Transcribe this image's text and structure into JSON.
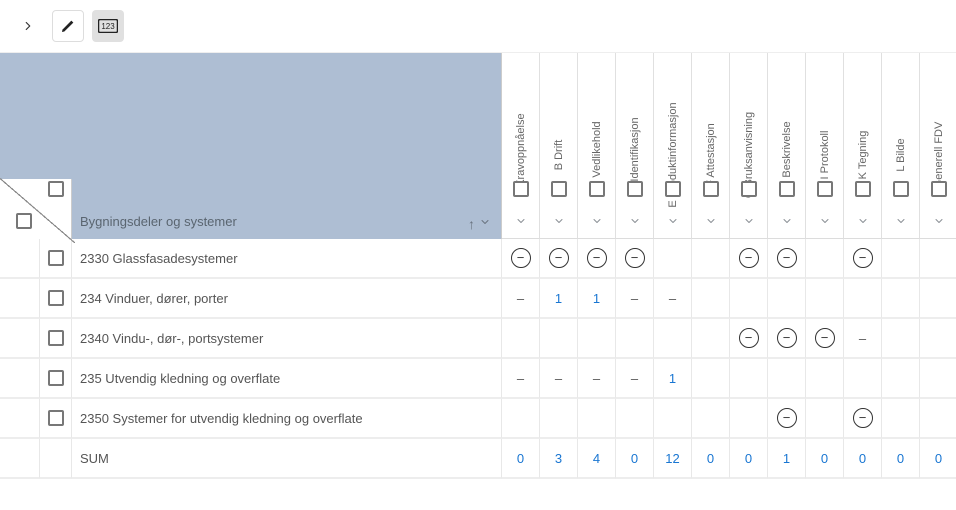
{
  "header": {
    "title": "Bygningsdeler og systemer",
    "columns": [
      {
        "key": "A",
        "label": "A Kravoppnåelse"
      },
      {
        "key": "B",
        "label": "B Drift"
      },
      {
        "key": "C",
        "label": "C Vedlikehold"
      },
      {
        "key": "D",
        "label": "D Identifikasjon"
      },
      {
        "key": "E",
        "label": "E Produktinformasjon"
      },
      {
        "key": "F",
        "label": "F Attestasjon"
      },
      {
        "key": "G",
        "label": "G Bruksanvisning"
      },
      {
        "key": "H",
        "label": "H Beskrivelse"
      },
      {
        "key": "I",
        "label": "I Protokoll"
      },
      {
        "key": "K",
        "label": "K Tegning"
      },
      {
        "key": "L",
        "label": "L Bilde"
      },
      {
        "key": "GEN",
        "label": "Generell FDV"
      }
    ]
  },
  "rows": [
    {
      "label": "2330 Glassfasadesystemer",
      "alt": true,
      "cells": [
        "m",
        "m",
        "m",
        "m",
        "",
        "",
        "m",
        "m",
        "",
        "m",
        "",
        ""
      ]
    },
    {
      "label": "234 Vinduer, dører, porter",
      "alt": false,
      "cells": [
        "d",
        "1",
        "1",
        "d",
        "d",
        "",
        "",
        "",
        "",
        "",
        "",
        ""
      ]
    },
    {
      "label": "2340 Vindu-, dør-, portsystemer",
      "alt": true,
      "cells": [
        "",
        "",
        "",
        "",
        "",
        "",
        "m",
        "m",
        "m",
        "d",
        "",
        ""
      ]
    },
    {
      "label": "235 Utvendig kledning og overflate",
      "alt": false,
      "cells": [
        "d",
        "d",
        "d",
        "d",
        "1",
        "",
        "",
        "",
        "",
        "",
        "",
        ""
      ]
    },
    {
      "label": "2350 Systemer for utvendig kledning og overflate",
      "alt": true,
      "cells": [
        "",
        "",
        "",
        "",
        "",
        "",
        "",
        "m",
        "",
        "m",
        "",
        ""
      ]
    }
  ],
  "sum": {
    "label": "SUM",
    "values": [
      "0",
      "3",
      "4",
      "0",
      "12",
      "0",
      "0",
      "1",
      "0",
      "0",
      "0",
      "0"
    ]
  }
}
